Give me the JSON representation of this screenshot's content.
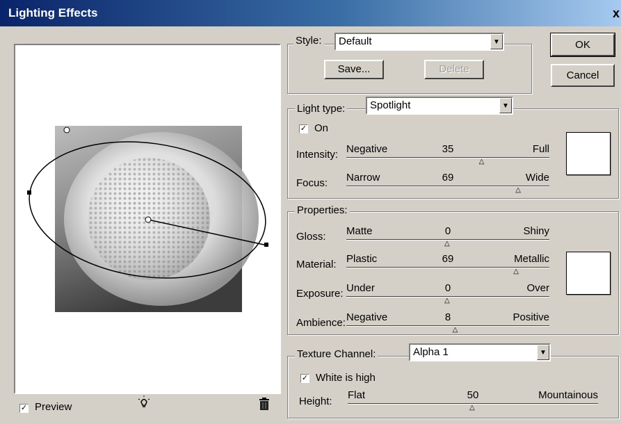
{
  "window": {
    "title": "Lighting Effects",
    "close_glyph": "x"
  },
  "buttons": {
    "ok": "OK",
    "cancel": "Cancel",
    "save": "Save...",
    "delete": "Delete"
  },
  "style": {
    "label": "Style:",
    "value": "Default"
  },
  "light_type": {
    "label": "Light type:",
    "value": "Spotlight",
    "on_label": "On",
    "on_checked": true,
    "intensity": {
      "label": "Intensity:",
      "left": "Negative",
      "right": "Full",
      "value": "35",
      "fraction": 0.67
    },
    "focus": {
      "label": "Focus:",
      "left": "Narrow",
      "right": "Wide",
      "value": "69",
      "fraction": 0.85
    },
    "color_swatch": "#ffffff"
  },
  "properties": {
    "title": "Properties:",
    "gloss": {
      "label": "Gloss:",
      "left": "Matte",
      "right": "Shiny",
      "value": "0",
      "fraction": 0.5
    },
    "material": {
      "label": "Material:",
      "left": "Plastic",
      "right": "Metallic",
      "value": "69",
      "fraction": 0.84
    },
    "exposure": {
      "label": "Exposure:",
      "left": "Under",
      "right": "Over",
      "value": "0",
      "fraction": 0.5
    },
    "ambience": {
      "label": "Ambience:",
      "left": "Negative",
      "right": "Positive",
      "value": "8",
      "fraction": 0.54
    },
    "color_swatch": "#ffffff"
  },
  "texture": {
    "label": "Texture Channel:",
    "value": "Alpha 1",
    "white_high_label": "White is high",
    "white_high_checked": true,
    "height": {
      "label": "Height:",
      "left": "Flat",
      "right": "Mountainous",
      "value": "50",
      "fraction": 0.5
    }
  },
  "preview": {
    "label": "Preview",
    "checked": true,
    "light_icon": "light-bulb-icon",
    "trash_icon": "trash-icon"
  },
  "colors": {
    "title_start": "#0a246a",
    "title_end": "#a6caf0",
    "face": "#d4d0c8"
  }
}
